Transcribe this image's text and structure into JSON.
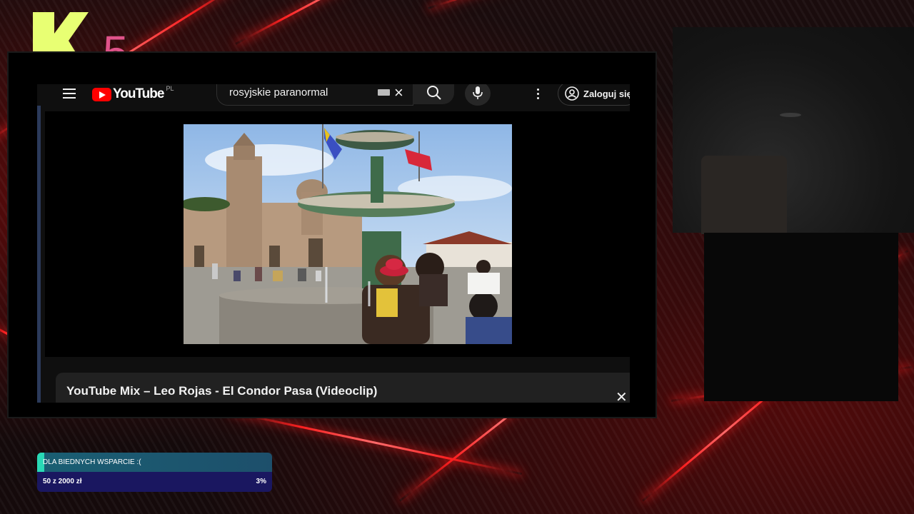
{
  "overlay": {
    "logo": {
      "letter": "K",
      "number": "5",
      "letter_color": "#e8ff73",
      "number_color": "#e0538a"
    },
    "accent_color": "#ff2020"
  },
  "youtube": {
    "logo_text": "YouTube",
    "region": "PL",
    "search": {
      "value": "rosyjskie paranormal"
    },
    "signin_label": "Zaloguj się",
    "mix_title": "YouTube Mix – Leo Rojas - El Condor Pasa (Videoclip)",
    "brand_color": "#ff0000"
  },
  "donation_goal": {
    "title": "DLA BIEDNYCH WSPARCIE :(",
    "amount": "50  z  2000  zł",
    "percent": "3%",
    "progress": 0.03
  }
}
